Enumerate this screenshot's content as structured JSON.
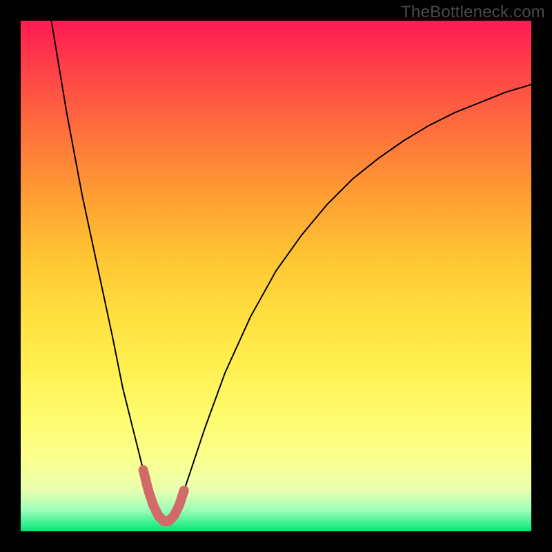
{
  "watermark": "TheBottleneck.com",
  "colors": {
    "curve": "#000000",
    "highlight": "#d36a6a",
    "background_top": "#ff1a53",
    "background_bottom": "#00e676",
    "page": "#000000"
  },
  "chart_data": {
    "type": "line",
    "title": "",
    "xlabel": "",
    "ylabel": "",
    "xlim": [
      0,
      100
    ],
    "ylim": [
      0,
      100
    ],
    "series": [
      {
        "name": "bottleneck-curve",
        "x": [
          6,
          9,
          12,
          15,
          18,
          20,
          22,
          24,
          25,
          26,
          27,
          28,
          29,
          30,
          31,
          32,
          34,
          36,
          40,
          45,
          50,
          55,
          60,
          65,
          70,
          75,
          80,
          85,
          90,
          95,
          100
        ],
        "values": [
          100,
          82,
          66,
          52,
          38,
          28,
          20,
          12,
          8,
          5,
          3,
          2,
          2,
          3,
          5,
          8,
          14,
          20,
          31,
          42,
          51,
          58,
          64,
          69,
          73,
          76.5,
          79.5,
          82,
          84,
          86,
          87.5
        ]
      }
    ],
    "highlight_region": {
      "name": "optimal-range",
      "x": [
        24,
        25,
        26,
        27,
        28,
        29,
        30,
        31,
        32
      ],
      "values": [
        12,
        8,
        5,
        3,
        2,
        2,
        3,
        5,
        8
      ]
    },
    "grid": false,
    "legend": false
  }
}
